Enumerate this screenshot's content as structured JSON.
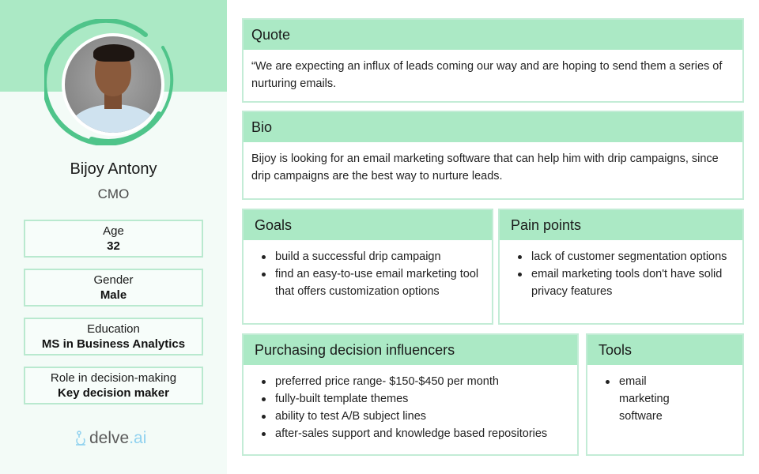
{
  "persona": {
    "name": "Bijoy Antony",
    "role": "CMO",
    "avatar_alt": "profile photo"
  },
  "attributes": [
    {
      "label": "Age",
      "value": "32"
    },
    {
      "label": "Gender",
      "value": "Male"
    },
    {
      "label": "Education",
      "value": "MS in Business Analytics"
    },
    {
      "label": "Role in decision-making",
      "value": "Key decision maker"
    }
  ],
  "logo": {
    "part1": "delve",
    "part2": ".ai",
    "icon": "microscope-icon"
  },
  "colors": {
    "accent": "#abe9c5",
    "ring": "#4fc48a",
    "logo_ai": "#8fd1ef"
  },
  "sections": {
    "quote": {
      "title": "Quote",
      "text": "“We are expecting an influx of leads coming our way and are hoping to send them a series of nurturing emails."
    },
    "bio": {
      "title": "Bio",
      "text": "Bijoy is looking for an email marketing software that can help him with drip campaigns, since drip campaigns are the best way to nurture leads."
    },
    "goals": {
      "title": "Goals",
      "items": [
        "build a successful drip campaign",
        "find an easy-to-use email marketing tool that offers customization options"
      ]
    },
    "pain_points": {
      "title": "Pain points",
      "items": [
        "lack of customer segmentation options",
        "email marketing tools don't have solid privacy features"
      ]
    },
    "influencers": {
      "title": "Purchasing decision influencers",
      "items": [
        "preferred price range- $150-$450 per month",
        "fully-built template themes",
        "ability to test A/B subject lines",
        "after-sales support and knowledge based repositories"
      ]
    },
    "tools": {
      "title": "Tools",
      "items": [
        "email marketing software"
      ]
    }
  }
}
